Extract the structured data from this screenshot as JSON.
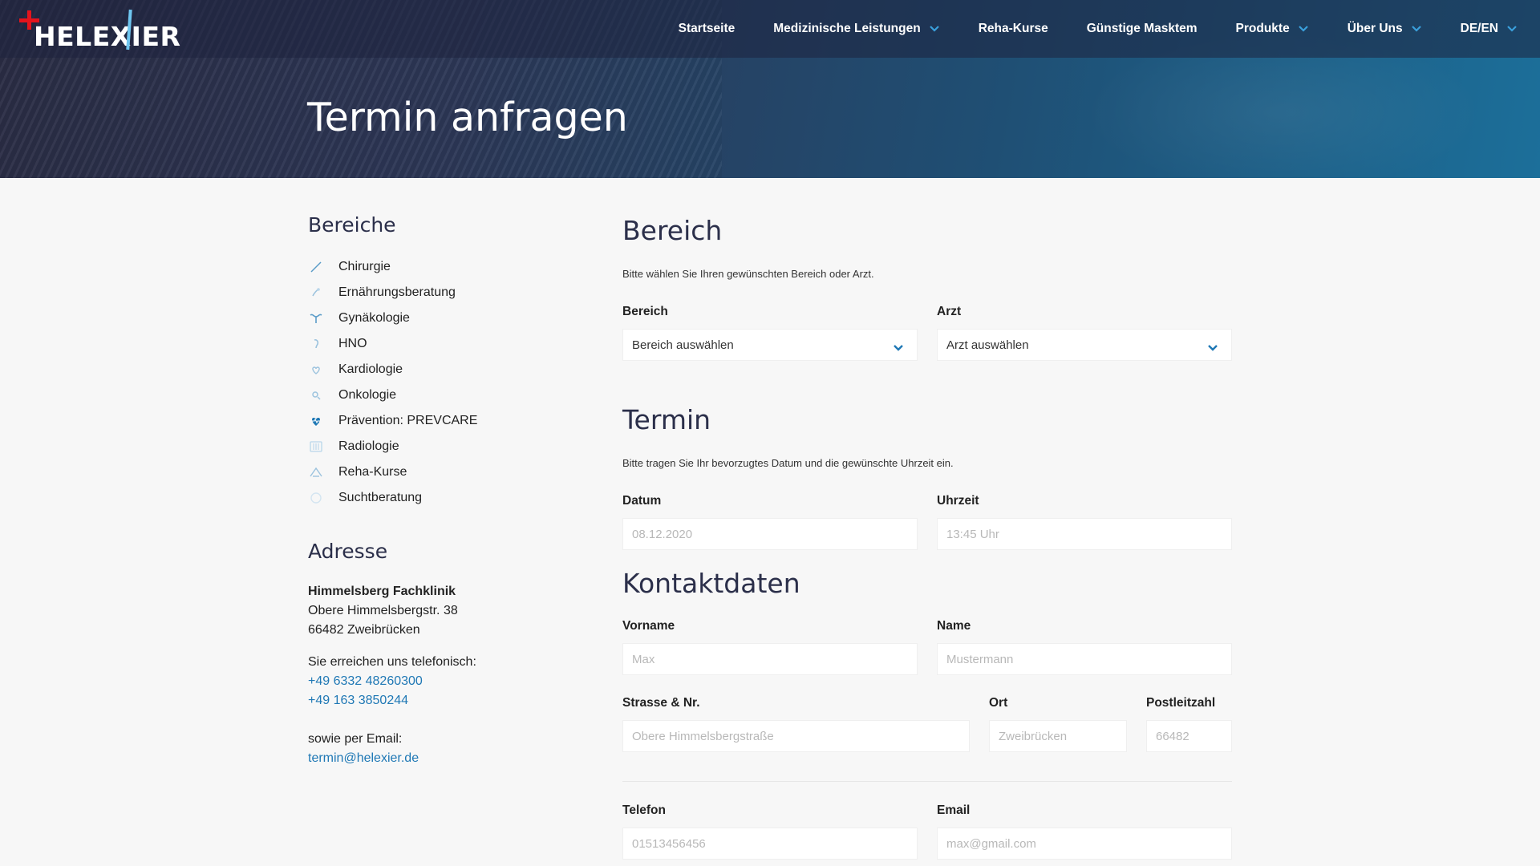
{
  "brand": {
    "logo_text": "HELEXIER",
    "accent": "#1f78b5",
    "logo_red": "#e4141c"
  },
  "nav": {
    "items": [
      {
        "label": "Startseite",
        "dropdown": false
      },
      {
        "label": "Medizinische Leistungen",
        "dropdown": true
      },
      {
        "label": "Reha-Kurse",
        "dropdown": false
      },
      {
        "label": "Günstige Masktem",
        "dropdown": false
      },
      {
        "label": "Produkte",
        "dropdown": true
      },
      {
        "label": "Über Uns",
        "dropdown": true
      },
      {
        "label": "DE/EN",
        "dropdown": true
      }
    ]
  },
  "page": {
    "title": "Termin anfragen"
  },
  "sidebar": {
    "areas_heading": "Bereiche",
    "areas": [
      {
        "label": "Chirurgie",
        "icon": "scalpel-icon"
      },
      {
        "label": "Ernährungsberatung",
        "icon": "nutrition-icon"
      },
      {
        "label": "Gynäkologie",
        "icon": "uterus-icon"
      },
      {
        "label": "HNO",
        "icon": "ear-icon"
      },
      {
        "label": "Kardiologie",
        "icon": "heart-icon"
      },
      {
        "label": "Onkologie",
        "icon": "cell-icon"
      },
      {
        "label": "Prävention: PREVCARE",
        "icon": "heart-pulse-icon"
      },
      {
        "label": "Radiologie",
        "icon": "xray-icon"
      },
      {
        "label": "Reha-Kurse",
        "icon": "rehab-icon"
      },
      {
        "label": "Suchtberatung",
        "icon": "circle-icon"
      }
    ],
    "address_heading": "Adresse",
    "address": {
      "org": "Himmelsberg Fachklinik",
      "street": "Obere Himmelsbergstr. 38",
      "city": "66482 Zweibrücken"
    },
    "phone_intro": "Sie erreichen uns telefonisch:",
    "phones": [
      "+49 6332 48260300",
      "+49 163 3850244"
    ],
    "email_intro": "sowie per Email:",
    "email": "termin@helexier.de"
  },
  "form": {
    "bereich": {
      "heading": "Bereich",
      "text": "Bitte wählen Sie Ihren gewünschten Bereich oder Arzt.",
      "bereich_label": "Bereich",
      "bereich_value": "Bereich auswählen",
      "arzt_label": "Arzt",
      "arzt_value": "Arzt auswählen"
    },
    "termin": {
      "heading": "Termin",
      "text": "Bitte tragen Sie Ihr bevorzugtes Datum und die gewünschte Uhrzeit ein.",
      "datum_label": "Datum",
      "datum_placeholder": "08.12.2020",
      "uhrzeit_label": "Uhrzeit",
      "uhrzeit_placeholder": "13:45 Uhr"
    },
    "kontakt": {
      "heading": "Kontaktdaten",
      "vorname_label": "Vorname",
      "vorname_placeholder": "Max",
      "name_label": "Name",
      "name_placeholder": "Mustermann",
      "strasse_label": "Strasse & Nr.",
      "strasse_placeholder": "Obere Himmelsbergstraße",
      "ort_label": "Ort",
      "ort_placeholder": "Zweibrücken",
      "plz_label": "Postleitzahl",
      "plz_placeholder": "66482",
      "telefon_label": "Telefon",
      "telefon_placeholder": "01513456456",
      "email_label": "Email",
      "email_placeholder": "max@gmail.com"
    }
  }
}
